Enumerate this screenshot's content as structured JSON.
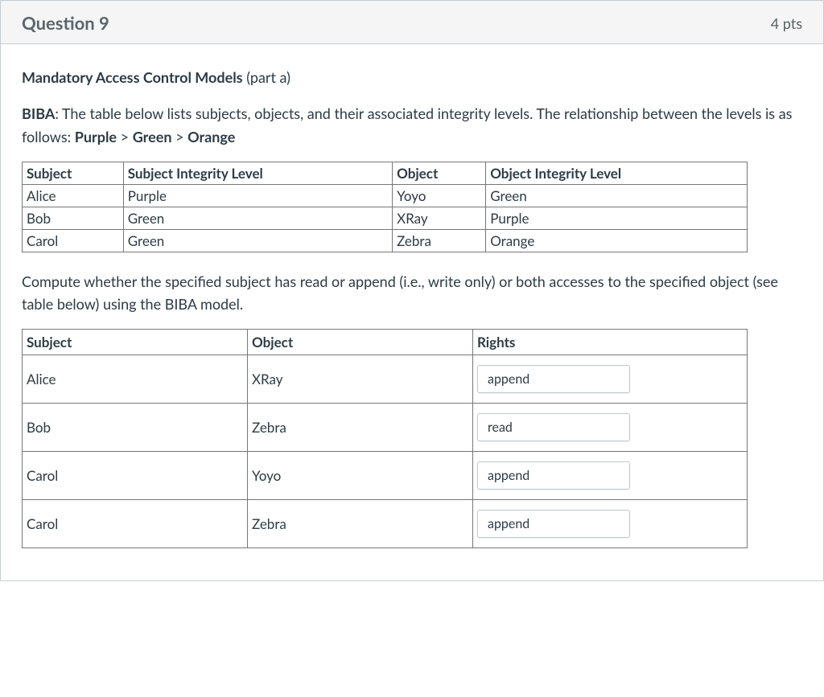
{
  "header": {
    "title": "Question 9",
    "points": "4 pts"
  },
  "section_title_bold": "Mandatory Access Control Models",
  "section_title_rest": " (part a)",
  "para1_lead_bold": "BIBA",
  "para1_rest1": ": The table below lists subjects, objects, and their associated integrity levels. The relationship between the levels is as follows: ",
  "rel_purple": "Purple",
  "rel_sep1": " > ",
  "rel_green": "Green",
  "rel_sep2": " > ",
  "rel_orange": "Orange",
  "table1": {
    "headers": [
      "Subject",
      "Subject Integrity Level",
      "Object",
      "Object Integrity Level"
    ],
    "rows": [
      [
        "Alice",
        "Purple",
        "Yoyo",
        "Green"
      ],
      [
        "Bob",
        "Green",
        "XRay",
        "Purple"
      ],
      [
        "Carol",
        "Green",
        "Zebra",
        "Orange"
      ]
    ]
  },
  "para2": "Compute whether the specified subject has read or append (i.e., write only) or both accesses to the specified object (see table below) using the BIBA model.",
  "table2": {
    "headers": [
      "Subject",
      "Object",
      "Rights"
    ],
    "rows": [
      {
        "subject": "Alice",
        "object": "XRay",
        "right": "append"
      },
      {
        "subject": "Bob",
        "object": "Zebra",
        "right": "read"
      },
      {
        "subject": "Carol",
        "object": "Yoyo",
        "right": "append"
      },
      {
        "subject": "Carol",
        "object": "Zebra",
        "right": "append"
      }
    ]
  }
}
